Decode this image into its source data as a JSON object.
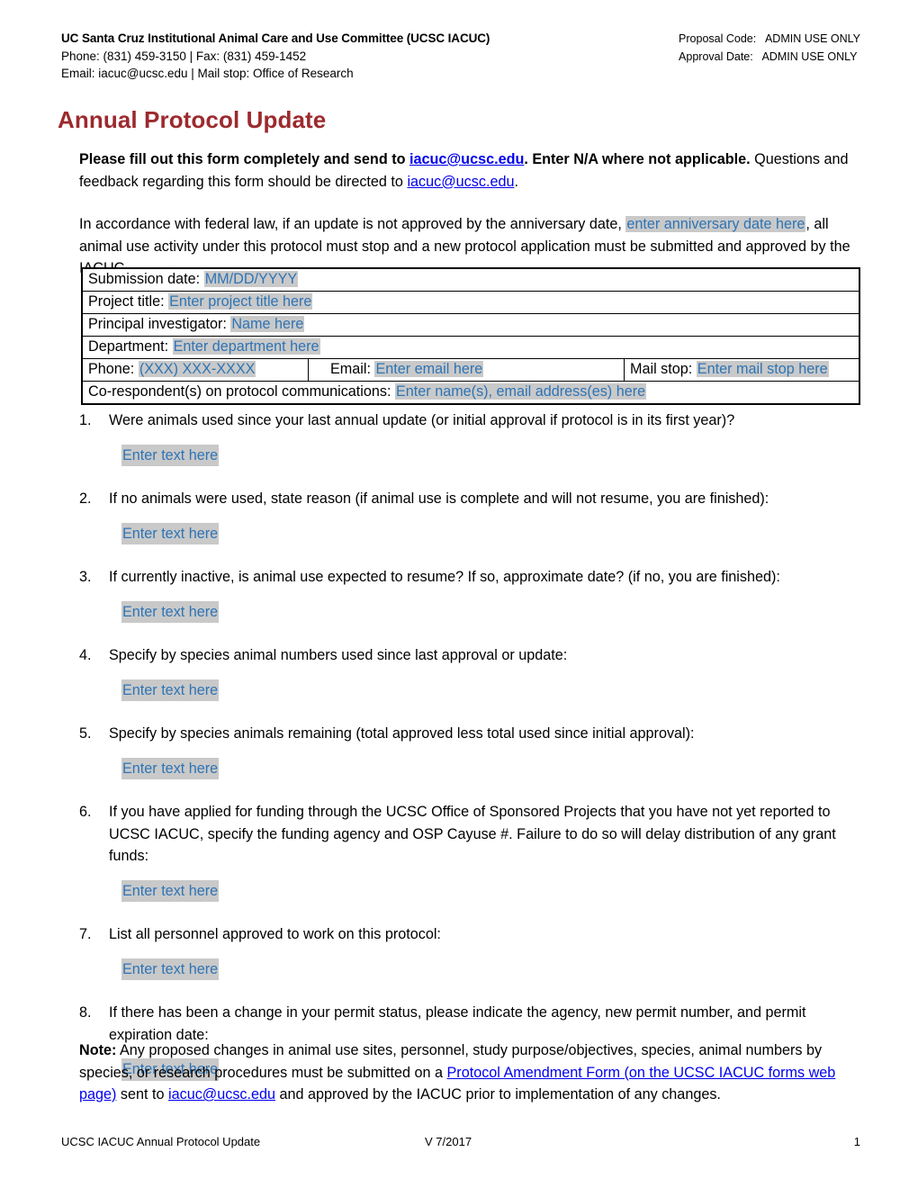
{
  "header": {
    "org": "UC Santa Cruz Institutional Animal Care and Use Committee (UCSC IACUC)",
    "contact_line1": "Phone: (831) 459-3150 | Fax: (831) 459-1452",
    "contact_line2": "Email: iacuc@ucsc.edu | Mail stop: Office of Research",
    "proposal_code_label": "Proposal Code:",
    "proposal_code_value": "ADMIN USE ONLY",
    "approval_date_label": "Approval Date:",
    "approval_date_value": "ADMIN USE ONLY"
  },
  "title": "Annual Protocol Update",
  "intro": {
    "bold_part1": "Please fill out this form completely and send to ",
    "link1": "iacuc@ucsc.edu",
    "bold_part2": ". Enter N/A where not applicable.",
    "normal_part": " Questions and feedback regarding this form should be directed to ",
    "link2": "iacuc@ucsc.edu",
    "period": "."
  },
  "federal_paragraph": {
    "part1": "In accordance with federal law, if an update is not approved by the anniversary date, ",
    "fill": "enter anniversary date here",
    "part2": ", all animal use activity under this protocol must stop and a new protocol application must be submitted and approved by the IACUC."
  },
  "info_table": {
    "rows": [
      {
        "label": "Submission date:",
        "fill": "MM/DD/YYYY"
      },
      {
        "label": "Project title:",
        "fill": "Enter project title here"
      },
      {
        "label": "Principal investigator:",
        "fill": "Name here"
      },
      {
        "label": "Department:",
        "fill": "Enter department here"
      }
    ],
    "contact_row": {
      "phone_label": "Phone:",
      "phone_fill": "(XXX) XXX-XXXX",
      "email_label": "Email:",
      "email_fill": "Enter email here",
      "mailstop_label": "Mail stop:",
      "mailstop_fill": "Enter mail stop here"
    },
    "corespondent_row": {
      "label": "Co-respondent(s) on protocol communications:",
      "fill": "Enter name(s), email address(es) here"
    }
  },
  "answer_placeholder": "Enter text here",
  "questions": [
    {
      "num": "1.",
      "text": "Were animals used since your last annual update (or initial approval if protocol is in its first year)?"
    },
    {
      "num": "2.",
      "text": "If no animals were used, state reason (if animal use is complete and will not resume, you are finished):"
    },
    {
      "num": "3.",
      "text": "If currently inactive, is animal use expected to resume? If so, approximate date? (if no, you are finished):"
    },
    {
      "num": "4.",
      "text": "Specify by species animal numbers used since last approval or update:"
    },
    {
      "num": "5.",
      "text": "Specify by species animals remaining (total approved less total used since initial approval):"
    },
    {
      "num": "6.",
      "text": "If you have applied for funding through the UCSC Office of Sponsored Projects that you have not yet reported to UCSC IACUC, specify the funding agency and OSP Cayuse #. Failure to do so will delay distribution of any grant funds:"
    },
    {
      "num": "7.",
      "text": "List all personnel approved to work on this protocol:"
    },
    {
      "num": "8.",
      "text": "If there has been a change in your permit status, please indicate the agency, new permit number, and permit expiration date:"
    }
  ],
  "note": {
    "label": "Note:",
    "part1": " Any proposed changes in animal use sites, personnel, study purpose/objectives, species, animal numbers by species, or research procedures must be submitted on a ",
    "link1": "Protocol Amendment Form (on the UCSC IACUC forms web page)",
    "part2": " sent to ",
    "link2": "iacuc@ucsc.edu",
    "part3": " and approved by the IACUC prior to implementation of any changes."
  },
  "footer": {
    "left": "UCSC IACUC Annual Protocol Update",
    "center": "V 7/2017",
    "right": "1"
  },
  "colors": {
    "title": "#9C2A2E",
    "link": "#0000EE",
    "fill_text": "#2E74B5",
    "fill_background": "#C9C9C9"
  }
}
